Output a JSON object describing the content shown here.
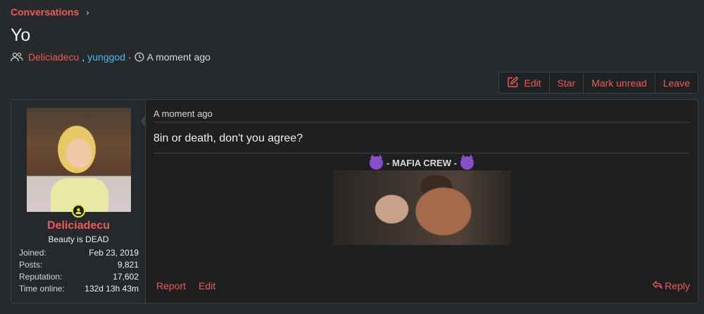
{
  "breadcrumb": {
    "label": "Conversations",
    "chevron": "›"
  },
  "conversation": {
    "title": "Yo",
    "participants": [
      "Deliciadecu",
      "yunggod"
    ],
    "separator": ",",
    "dot": "·",
    "started": "A moment ago"
  },
  "actions": {
    "edit": "Edit",
    "star": "Star",
    "mark_unread": "Mark unread",
    "leave": "Leave"
  },
  "post": {
    "user": {
      "name": "Deliciadecu",
      "title": "Beauty is DEAD",
      "stats": [
        {
          "key": "Joined:",
          "value": "Feb 23, 2019"
        },
        {
          "key": "Posts:",
          "value": "9,821"
        },
        {
          "key": "Reputation:",
          "value": "17,602"
        },
        {
          "key": "Time online:",
          "value": "132d 13h 43m"
        }
      ]
    },
    "date": "A moment ago",
    "body": "8in or death, don't you agree?",
    "signature": "- MAFIA CREW -",
    "footer": {
      "report": "Report",
      "edit": "Edit",
      "reply": "Reply"
    }
  },
  "colors": {
    "accent": "#ec5a5a",
    "link_blue": "#49b6f0",
    "background": "#272a2d"
  }
}
